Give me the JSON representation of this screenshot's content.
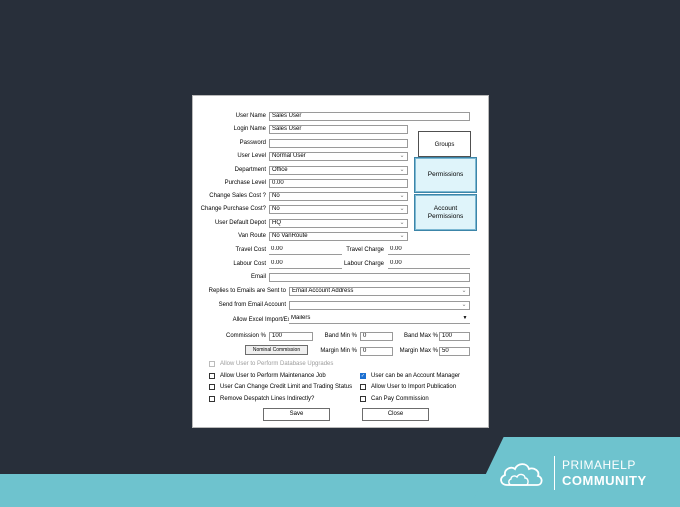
{
  "form": {
    "user_name": {
      "label": "User Name",
      "value": "Sales User"
    },
    "login_name": {
      "label": "Login Name",
      "value": "Sales User"
    },
    "password": {
      "label": "Password",
      "value": ""
    },
    "user_level": {
      "label": "User Level",
      "value": "Normal User"
    },
    "department": {
      "label": "Department",
      "value": "Office"
    },
    "purchase_level": {
      "label": "Purchase Level",
      "value": "0.00"
    },
    "change_sales_cost": {
      "label": "Change Sales Cost ?",
      "value": "No"
    },
    "change_purchase_cost": {
      "label": "Change Purchase Cost?",
      "value": "No"
    },
    "user_default_depot": {
      "label": "User Default Depot",
      "value": "HQ"
    },
    "van_route": {
      "label": "Van Route",
      "value": "No VanRoute"
    },
    "travel_cost": {
      "label": "Travel Cost",
      "value": "0.00"
    },
    "travel_charge": {
      "label": "Travel Charge",
      "value": "0.00"
    },
    "labour_cost": {
      "label": "Labour Cost",
      "value": "0.00"
    },
    "labour_charge": {
      "label": "Labour Charge",
      "value": "0.00"
    },
    "email": {
      "label": "Email",
      "value": ""
    },
    "replies_to": {
      "label": "Replies to Emails are Sent to",
      "value": "Email Account Address"
    },
    "send_from": {
      "label": "Send from Email Account",
      "value": ""
    },
    "allow_excel": {
      "label": "Allow Excel Import/Export",
      "value": "Mailers"
    },
    "commission": {
      "label": "Commission %",
      "value": "100"
    },
    "band_min": {
      "label": "Band Min %",
      "value": "0"
    },
    "band_max": {
      "label": "Band Max %",
      "value": "100"
    },
    "margin_min": {
      "label": "Margin Min %",
      "value": "0"
    },
    "margin_max": {
      "label": "Margin Max %",
      "value": "50"
    }
  },
  "buttons": {
    "groups": "Groups",
    "permissions": "Permissions",
    "account_permissions": "Account Permissions",
    "nominal_commission": "Nominal Commission",
    "save": "Save",
    "close": "Close"
  },
  "checkboxes": {
    "db_upgrades": {
      "label": "Allow User to Perform Database Upgrades",
      "checked": false,
      "enabled": false
    },
    "maintenance_job": {
      "label": "Allow User to Perform Maintenance Job",
      "checked": false,
      "enabled": true
    },
    "credit_limit": {
      "label": "User Can Change Credit Limit and Trading Status",
      "checked": false,
      "enabled": true
    },
    "despatch_lines": {
      "label": "Remove Despatch Lines Indirectly?",
      "checked": false,
      "enabled": true
    },
    "account_manager": {
      "label": "User can be an Account Manager",
      "checked": true,
      "enabled": true
    },
    "import_publication": {
      "label": "Allow User to Import Publication",
      "checked": false,
      "enabled": true
    },
    "pay_commission": {
      "label": "Can Pay Commission",
      "checked": false,
      "enabled": true
    }
  },
  "brand": {
    "line1": "PRIMAHELP",
    "line2": "COMMUNITY",
    "icon": "cloud-icon"
  },
  "colors": {
    "background": "#282f3a",
    "accent_teal": "#6ec3ce",
    "button_highlight": "#dff4fa",
    "check_blue": "#1b6fd1"
  }
}
